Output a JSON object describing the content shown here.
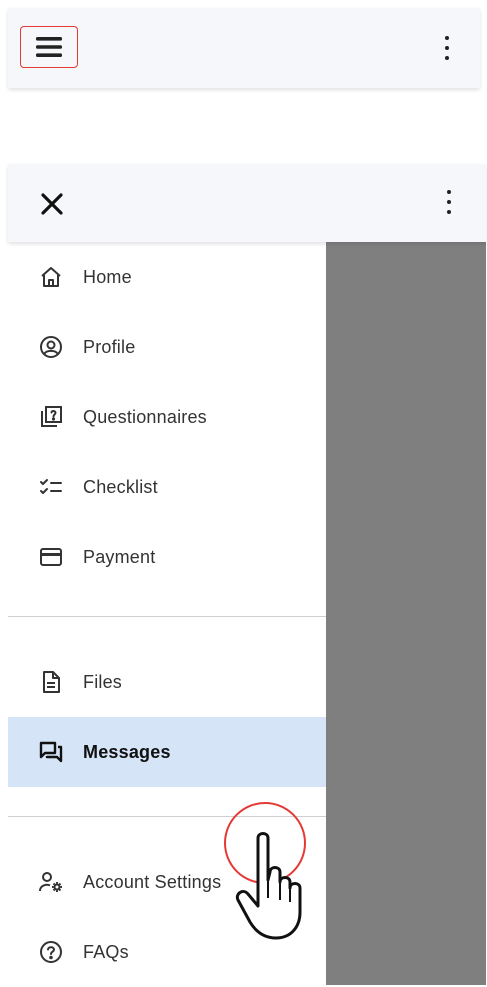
{
  "top_frame": {
    "menu_icon": "hamburger-icon",
    "more_icon": "more-vertical-icon"
  },
  "drawer_frame": {
    "close_icon": "close-icon",
    "more_icon": "more-vertical-icon"
  },
  "nav": {
    "items": [
      {
        "label": "Home",
        "icon": "home-icon"
      },
      {
        "label": "Profile",
        "icon": "profile-icon"
      },
      {
        "label": "Questionnaires",
        "icon": "questionnaire-icon"
      },
      {
        "label": "Checklist",
        "icon": "checklist-icon"
      },
      {
        "label": "Payment",
        "icon": "credit-card-icon"
      },
      {
        "label": "Files",
        "icon": "file-icon"
      },
      {
        "label": "Messages",
        "icon": "messages-icon",
        "active": true
      },
      {
        "label": "Account Settings",
        "icon": "account-settings-icon"
      },
      {
        "label": "FAQs",
        "icon": "help-circle-icon"
      }
    ]
  },
  "colors": {
    "topbar_bg": "#f6f7fb",
    "active_bg": "#d6e4f7",
    "overlay": "#7f7f80",
    "highlight_red": "#e53935"
  }
}
